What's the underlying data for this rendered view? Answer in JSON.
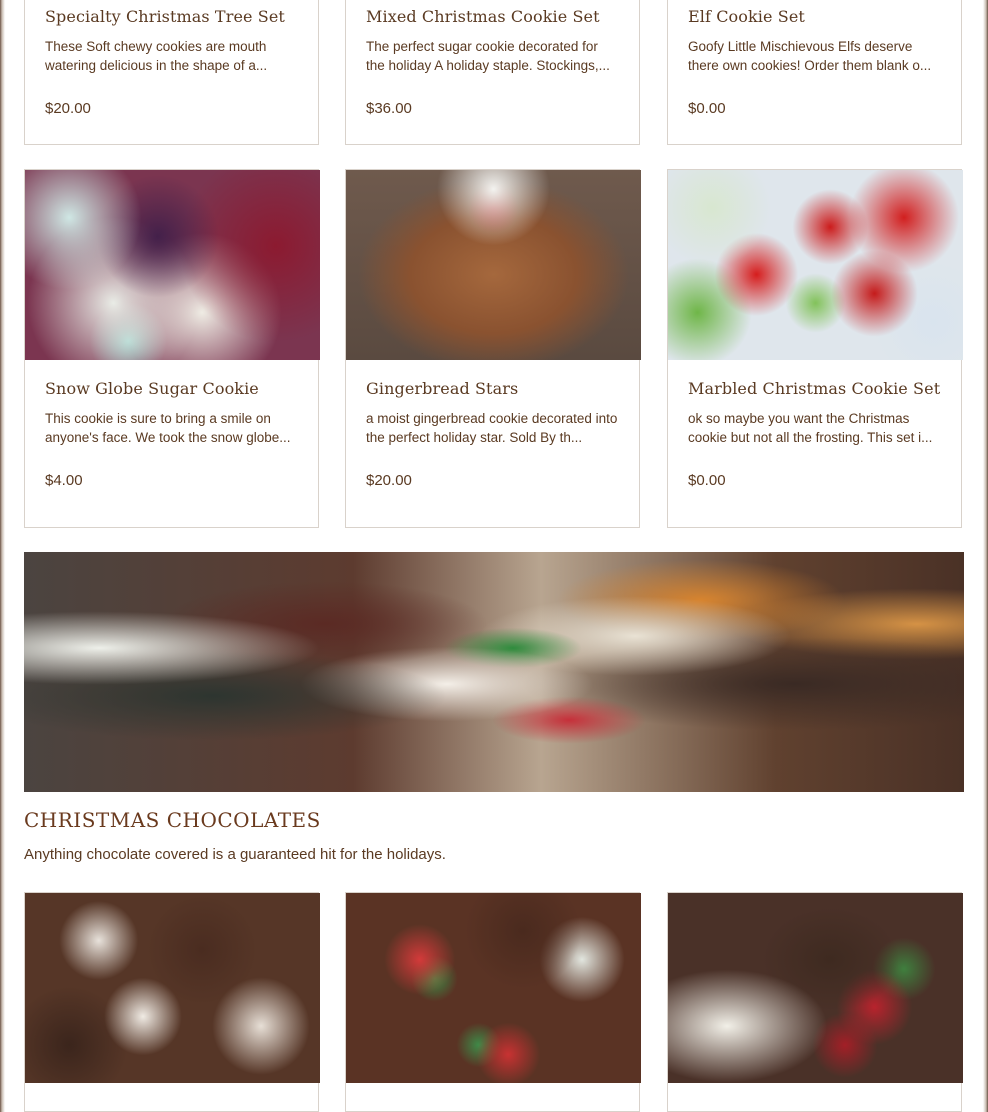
{
  "products_row1": [
    {
      "title": "Specialty Christmas Tree Set",
      "desc": "These Soft chewy cookies are mouth watering delicious in the shape of a...",
      "price": "$20.00",
      "image": "christmas-tree-cookie-photo"
    },
    {
      "title": "Mixed Christmas Cookie Set",
      "desc": "The perfect sugar cookie decorated for the holiday A holiday staple. Stockings,...",
      "price": "$36.00",
      "image": "mixed-cookie-photo"
    },
    {
      "title": "Elf Cookie Set",
      "desc": "Goofy Little Mischievous Elfs deserve there own cookies! Order them blank o...",
      "price": "$0.00",
      "image": "elf-cookie-photo"
    }
  ],
  "products_row2": [
    {
      "title": "Snow Globe Sugar Cookie",
      "desc": "This cookie is sure to bring a smile on anyone's face. We took the snow globe...",
      "price": "$4.00",
      "image": "snow-globe-cookie-photo"
    },
    {
      "title": "Gingerbread Stars",
      "desc": "a moist gingerbread cookie decorated into the perfect holiday star. Sold By th...",
      "price": "$20.00",
      "image": "gingerbread-star-photo"
    },
    {
      "title": "Marbled Christmas Cookie Set",
      "desc": "ok so maybe you want the Christmas cookie but not all the frosting. This set i...",
      "price": "$0.00",
      "image": "marbled-cookie-photo"
    }
  ],
  "chocolates_section": {
    "title": "CHRISTMAS CHOCOLATES",
    "description": "Anything chocolate covered is a guaranteed hit for the holidays.",
    "banner_image": "chocolates-banner-photo"
  },
  "products_row3": [
    {
      "image": "chocolate-pretzels-photo"
    },
    {
      "image": "chocolate-cookies-photo"
    },
    {
      "image": "chocolate-strawberries-photo"
    }
  ]
}
